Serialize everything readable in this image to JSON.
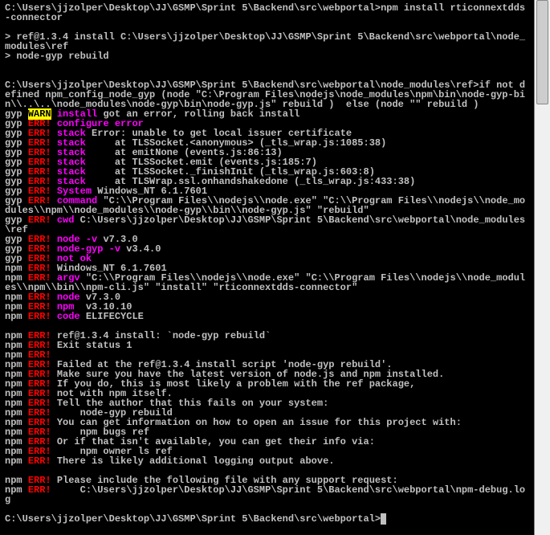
{
  "lines": [
    {
      "segments": [
        {
          "text": "C:\\Users\\jjzolper\\Desktop\\JJ\\GSMP\\Sprint 5\\Backend\\src\\webportal>npm install rticonnextdds-connector",
          "class": ""
        }
      ]
    },
    {
      "segments": [
        {
          "text": "",
          "class": ""
        }
      ]
    },
    {
      "segments": [
        {
          "text": "> ref@1.3.4 install C:\\Users\\jjzolper\\Desktop\\JJ\\GSMP\\Sprint 5\\Backend\\src\\webportal\\node_modules\\ref",
          "class": ""
        }
      ]
    },
    {
      "segments": [
        {
          "text": "> node-gyp rebuild",
          "class": ""
        }
      ]
    },
    {
      "segments": [
        {
          "text": "",
          "class": ""
        }
      ]
    },
    {
      "segments": [
        {
          "text": "",
          "class": ""
        }
      ]
    },
    {
      "segments": [
        {
          "text": "C:\\Users\\jjzolper\\Desktop\\JJ\\GSMP\\Sprint 5\\Backend\\src\\webportal\\node_modules\\ref>if not defined npm_config_node_gyp (node \"C:\\Program Files\\nodejs\\node_modules\\npm\\bin\\node-gyp-bin\\\\..\\..\\node_modules\\node-gyp\\bin\\node-gyp.js\" rebuild )  else (node \"\" rebuild )",
          "class": ""
        }
      ]
    },
    {
      "segments": [
        {
          "text": "gyp ",
          "class": ""
        },
        {
          "text": "WARN",
          "class": "warn"
        },
        {
          "text": " ",
          "class": ""
        },
        {
          "text": "install",
          "class": "err-magenta"
        },
        {
          "text": " got an error, rolling back install",
          "class": ""
        }
      ]
    },
    {
      "segments": [
        {
          "text": "gyp ",
          "class": ""
        },
        {
          "text": "ERR!",
          "class": "err-red"
        },
        {
          "text": " ",
          "class": ""
        },
        {
          "text": "configure error",
          "class": "err-magenta"
        },
        {
          "text": "",
          "class": ""
        }
      ]
    },
    {
      "segments": [
        {
          "text": "gyp ",
          "class": ""
        },
        {
          "text": "ERR!",
          "class": "err-red"
        },
        {
          "text": " ",
          "class": ""
        },
        {
          "text": "stack",
          "class": "err-magenta"
        },
        {
          "text": " Error: unable to get local issuer certificate",
          "class": ""
        }
      ]
    },
    {
      "segments": [
        {
          "text": "gyp ",
          "class": ""
        },
        {
          "text": "ERR!",
          "class": "err-red"
        },
        {
          "text": " ",
          "class": ""
        },
        {
          "text": "stack",
          "class": "err-magenta"
        },
        {
          "text": "     at TLSSocket.<anonymous> (_tls_wrap.js:1085:38)",
          "class": ""
        }
      ]
    },
    {
      "segments": [
        {
          "text": "gyp ",
          "class": ""
        },
        {
          "text": "ERR!",
          "class": "err-red"
        },
        {
          "text": " ",
          "class": ""
        },
        {
          "text": "stack",
          "class": "err-magenta"
        },
        {
          "text": "     at emitNone (events.js:86:13)",
          "class": ""
        }
      ]
    },
    {
      "segments": [
        {
          "text": "gyp ",
          "class": ""
        },
        {
          "text": "ERR!",
          "class": "err-red"
        },
        {
          "text": " ",
          "class": ""
        },
        {
          "text": "stack",
          "class": "err-magenta"
        },
        {
          "text": "     at TLSSocket.emit (events.js:185:7)",
          "class": ""
        }
      ]
    },
    {
      "segments": [
        {
          "text": "gyp ",
          "class": ""
        },
        {
          "text": "ERR!",
          "class": "err-red"
        },
        {
          "text": " ",
          "class": ""
        },
        {
          "text": "stack",
          "class": "err-magenta"
        },
        {
          "text": "     at TLSSocket._finishInit (_tls_wrap.js:603:8)",
          "class": ""
        }
      ]
    },
    {
      "segments": [
        {
          "text": "gyp ",
          "class": ""
        },
        {
          "text": "ERR!",
          "class": "err-red"
        },
        {
          "text": " ",
          "class": ""
        },
        {
          "text": "stack",
          "class": "err-magenta"
        },
        {
          "text": "     at TLSWrap.ssl.onhandshakedone (_tls_wrap.js:433:38)",
          "class": ""
        }
      ]
    },
    {
      "segments": [
        {
          "text": "gyp ",
          "class": ""
        },
        {
          "text": "ERR!",
          "class": "err-red"
        },
        {
          "text": " ",
          "class": ""
        },
        {
          "text": "System",
          "class": "err-magenta"
        },
        {
          "text": " Windows_NT 6.1.7601",
          "class": ""
        }
      ]
    },
    {
      "segments": [
        {
          "text": "gyp ",
          "class": ""
        },
        {
          "text": "ERR!",
          "class": "err-red"
        },
        {
          "text": " ",
          "class": ""
        },
        {
          "text": "command",
          "class": "err-magenta"
        },
        {
          "text": " \"C:\\\\Program Files\\\\nodejs\\\\node.exe\" \"C:\\\\Program Files\\\\nodejs\\\\node_modules\\\\npm\\\\node_modules\\\\node-gyp\\\\bin\\\\node-gyp.js\" \"rebuild\"",
          "class": ""
        }
      ]
    },
    {
      "segments": [
        {
          "text": "gyp ",
          "class": ""
        },
        {
          "text": "ERR!",
          "class": "err-red"
        },
        {
          "text": " ",
          "class": ""
        },
        {
          "text": "cwd",
          "class": "err-magenta"
        },
        {
          "text": " C:\\Users\\jjzolper\\Desktop\\JJ\\GSMP\\Sprint 5\\Backend\\src\\webportal\\node_modules\\ref",
          "class": ""
        }
      ]
    },
    {
      "segments": [
        {
          "text": "gyp ",
          "class": ""
        },
        {
          "text": "ERR!",
          "class": "err-red"
        },
        {
          "text": " ",
          "class": ""
        },
        {
          "text": "node -v",
          "class": "err-magenta"
        },
        {
          "text": " v7.3.0",
          "class": ""
        }
      ]
    },
    {
      "segments": [
        {
          "text": "gyp ",
          "class": ""
        },
        {
          "text": "ERR!",
          "class": "err-red"
        },
        {
          "text": " ",
          "class": ""
        },
        {
          "text": "node-gyp -v",
          "class": "err-magenta"
        },
        {
          "text": " v3.4.0",
          "class": ""
        }
      ]
    },
    {
      "segments": [
        {
          "text": "gyp ",
          "class": ""
        },
        {
          "text": "ERR!",
          "class": "err-red"
        },
        {
          "text": " ",
          "class": ""
        },
        {
          "text": "not ok",
          "class": "err-magenta"
        },
        {
          "text": "",
          "class": ""
        }
      ]
    },
    {
      "segments": [
        {
          "text": "npm ",
          "class": ""
        },
        {
          "text": "ERR!",
          "class": "err-red"
        },
        {
          "text": " Windows_NT 6.1.7601",
          "class": ""
        }
      ]
    },
    {
      "segments": [
        {
          "text": "npm ",
          "class": ""
        },
        {
          "text": "ERR!",
          "class": "err-red"
        },
        {
          "text": " ",
          "class": ""
        },
        {
          "text": "argv",
          "class": "err-magenta"
        },
        {
          "text": " \"C:\\\\Program Files\\\\nodejs\\\\node.exe\" \"C:\\\\Program Files\\\\nodejs\\\\node_modules\\\\npm\\\\bin\\\\npm-cli.js\" \"install\" \"rticonnextdds-connector\"",
          "class": ""
        }
      ]
    },
    {
      "segments": [
        {
          "text": "npm ",
          "class": ""
        },
        {
          "text": "ERR!",
          "class": "err-red"
        },
        {
          "text": " ",
          "class": ""
        },
        {
          "text": "node",
          "class": "err-magenta"
        },
        {
          "text": " v7.3.0",
          "class": ""
        }
      ]
    },
    {
      "segments": [
        {
          "text": "npm ",
          "class": ""
        },
        {
          "text": "ERR!",
          "class": "err-red"
        },
        {
          "text": " ",
          "class": ""
        },
        {
          "text": "npm ",
          "class": "err-magenta"
        },
        {
          "text": " v3.10.10",
          "class": ""
        }
      ]
    },
    {
      "segments": [
        {
          "text": "npm ",
          "class": ""
        },
        {
          "text": "ERR!",
          "class": "err-red"
        },
        {
          "text": " ",
          "class": ""
        },
        {
          "text": "code",
          "class": "err-magenta"
        },
        {
          "text": " ELIFECYCLE",
          "class": ""
        }
      ]
    },
    {
      "segments": [
        {
          "text": "",
          "class": ""
        }
      ]
    },
    {
      "segments": [
        {
          "text": "npm ",
          "class": ""
        },
        {
          "text": "ERR!",
          "class": "err-red"
        },
        {
          "text": " ref@1.3.4 install: `node-gyp rebuild`",
          "class": ""
        }
      ]
    },
    {
      "segments": [
        {
          "text": "npm ",
          "class": ""
        },
        {
          "text": "ERR!",
          "class": "err-red"
        },
        {
          "text": " Exit status 1",
          "class": ""
        }
      ]
    },
    {
      "segments": [
        {
          "text": "npm ",
          "class": ""
        },
        {
          "text": "ERR!",
          "class": "err-red"
        },
        {
          "text": "",
          "class": ""
        }
      ]
    },
    {
      "segments": [
        {
          "text": "npm ",
          "class": ""
        },
        {
          "text": "ERR!",
          "class": "err-red"
        },
        {
          "text": " Failed at the ref@1.3.4 install script 'node-gyp rebuild'.",
          "class": ""
        }
      ]
    },
    {
      "segments": [
        {
          "text": "npm ",
          "class": ""
        },
        {
          "text": "ERR!",
          "class": "err-red"
        },
        {
          "text": " Make sure you have the latest version of node.js and npm installed.",
          "class": ""
        }
      ]
    },
    {
      "segments": [
        {
          "text": "npm ",
          "class": ""
        },
        {
          "text": "ERR!",
          "class": "err-red"
        },
        {
          "text": " If you do, this is most likely a problem with the ref package,",
          "class": ""
        }
      ]
    },
    {
      "segments": [
        {
          "text": "npm ",
          "class": ""
        },
        {
          "text": "ERR!",
          "class": "err-red"
        },
        {
          "text": " not with npm itself.",
          "class": ""
        }
      ]
    },
    {
      "segments": [
        {
          "text": "npm ",
          "class": ""
        },
        {
          "text": "ERR!",
          "class": "err-red"
        },
        {
          "text": " Tell the author that this fails on your system:",
          "class": ""
        }
      ]
    },
    {
      "segments": [
        {
          "text": "npm ",
          "class": ""
        },
        {
          "text": "ERR!",
          "class": "err-red"
        },
        {
          "text": "     node-gyp rebuild",
          "class": ""
        }
      ]
    },
    {
      "segments": [
        {
          "text": "npm ",
          "class": ""
        },
        {
          "text": "ERR!",
          "class": "err-red"
        },
        {
          "text": " You can get information on how to open an issue for this project with:",
          "class": ""
        }
      ]
    },
    {
      "segments": [
        {
          "text": "npm ",
          "class": ""
        },
        {
          "text": "ERR!",
          "class": "err-red"
        },
        {
          "text": "     npm bugs ref",
          "class": ""
        }
      ]
    },
    {
      "segments": [
        {
          "text": "npm ",
          "class": ""
        },
        {
          "text": "ERR!",
          "class": "err-red"
        },
        {
          "text": " Or if that isn't available, you can get their info via:",
          "class": ""
        }
      ]
    },
    {
      "segments": [
        {
          "text": "npm ",
          "class": ""
        },
        {
          "text": "ERR!",
          "class": "err-red"
        },
        {
          "text": "     npm owner ls ref",
          "class": ""
        }
      ]
    },
    {
      "segments": [
        {
          "text": "npm ",
          "class": ""
        },
        {
          "text": "ERR!",
          "class": "err-red"
        },
        {
          "text": " There is likely additional logging output above.",
          "class": ""
        }
      ]
    },
    {
      "segments": [
        {
          "text": "",
          "class": ""
        }
      ]
    },
    {
      "segments": [
        {
          "text": "npm ",
          "class": ""
        },
        {
          "text": "ERR!",
          "class": "err-red"
        },
        {
          "text": " Please include the following file with any support request:",
          "class": ""
        }
      ]
    },
    {
      "segments": [
        {
          "text": "npm ",
          "class": ""
        },
        {
          "text": "ERR!",
          "class": "err-red"
        },
        {
          "text": "     C:\\Users\\jjzolper\\Desktop\\JJ\\GSMP\\Sprint 5\\Backend\\src\\webportal\\npm-debug.log",
          "class": ""
        }
      ]
    },
    {
      "segments": [
        {
          "text": "",
          "class": ""
        }
      ]
    },
    {
      "segments": [
        {
          "text": "C:\\Users\\jjzolper\\Desktop\\JJ\\GSMP\\Sprint 5\\Backend\\src\\webportal>",
          "class": ""
        },
        {
          "text": " ",
          "class": "cursor"
        }
      ]
    }
  ]
}
